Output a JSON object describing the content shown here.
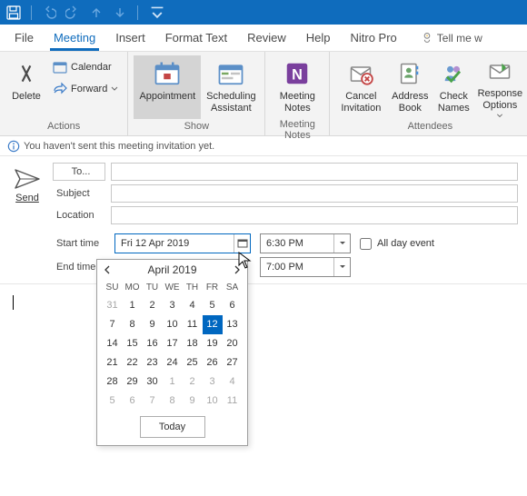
{
  "qat": {
    "save_icon": "save-icon",
    "undo_icon": "undo-icon",
    "redo_icon": "redo-icon",
    "up_icon": "arrow-up-icon",
    "down_icon": "arrow-down-icon"
  },
  "tabs": {
    "file": "File",
    "meeting": "Meeting",
    "insert": "Insert",
    "format_text": "Format Text",
    "review": "Review",
    "help": "Help",
    "nitro": "Nitro Pro",
    "tellme": "Tell me w"
  },
  "ribbon": {
    "actions": {
      "delete": "Delete",
      "calendar": "Calendar",
      "forward": "Forward",
      "group_label": "Actions"
    },
    "show": {
      "appointment": "Appointment",
      "scheduling": "Scheduling Assistant",
      "group_label": "Show"
    },
    "meeting_notes": {
      "btn": "Meeting Notes",
      "group_label": "Meeting Notes"
    },
    "attendees": {
      "cancel": "Cancel Invitation",
      "address": "Address Book",
      "check": "Check Names",
      "response": "Response Options",
      "group_label": "Attendees"
    }
  },
  "infobar": "You haven't sent this meeting invitation yet.",
  "form": {
    "send": "Send",
    "to_label": "To...",
    "subject_label": "Subject",
    "location_label": "Location",
    "start_label": "Start time",
    "end_label": "End time",
    "start_date": "Fri 12 Apr 2019",
    "end_date": "",
    "start_time": "6:30 PM",
    "end_time": "7:00 PM",
    "allday": "All day event",
    "to_value": "",
    "subject_value": "",
    "location_value": ""
  },
  "datepicker": {
    "title": "April 2019",
    "dow": [
      "SU",
      "MO",
      "TU",
      "WE",
      "TH",
      "FR",
      "SA"
    ],
    "weeks": [
      [
        {
          "d": 31,
          "o": true
        },
        {
          "d": 1
        },
        {
          "d": 2
        },
        {
          "d": 3
        },
        {
          "d": 4
        },
        {
          "d": 5
        },
        {
          "d": 6
        }
      ],
      [
        {
          "d": 7
        },
        {
          "d": 8
        },
        {
          "d": 9
        },
        {
          "d": 10
        },
        {
          "d": 11
        },
        {
          "d": 12,
          "sel": true
        },
        {
          "d": 13
        }
      ],
      [
        {
          "d": 14
        },
        {
          "d": 15
        },
        {
          "d": 16
        },
        {
          "d": 17
        },
        {
          "d": 18
        },
        {
          "d": 19
        },
        {
          "d": 20
        }
      ],
      [
        {
          "d": 21
        },
        {
          "d": 22
        },
        {
          "d": 23
        },
        {
          "d": 24
        },
        {
          "d": 25
        },
        {
          "d": 26
        },
        {
          "d": 27
        }
      ],
      [
        {
          "d": 28
        },
        {
          "d": 29
        },
        {
          "d": 30
        },
        {
          "d": 1,
          "o": true
        },
        {
          "d": 2,
          "o": true
        },
        {
          "d": 3,
          "o": true
        },
        {
          "d": 4,
          "o": true
        }
      ],
      [
        {
          "d": 5,
          "o": true
        },
        {
          "d": 6,
          "o": true
        },
        {
          "d": 7,
          "o": true
        },
        {
          "d": 8,
          "o": true
        },
        {
          "d": 9,
          "o": true
        },
        {
          "d": 10,
          "o": true
        },
        {
          "d": 11,
          "o": true
        }
      ]
    ],
    "today": "Today"
  }
}
